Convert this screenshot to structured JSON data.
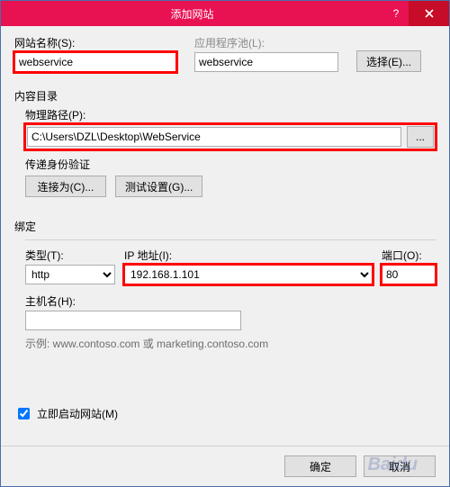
{
  "title": "添加网站",
  "site_name_label": "网站名称(S):",
  "site_name_value": "webservice",
  "app_pool_label": "应用程序池(L):",
  "app_pool_value": "webservice",
  "select_btn": "选择(E)...",
  "content_dir_title": "内容目录",
  "physical_path_label": "物理路径(P):",
  "physical_path_value": "C:\\Users\\DZL\\Desktop\\WebService",
  "browse_btn": "...",
  "auth_label": "传递身份验证",
  "connect_as_btn": "连接为(C)...",
  "test_settings_btn": "测试设置(G)...",
  "binding_title": "绑定",
  "type_label": "类型(T):",
  "type_value": "http",
  "ip_label": "IP 地址(I):",
  "ip_value": "192.168.1.101",
  "port_label": "端口(O):",
  "port_value": "80",
  "hostname_label": "主机名(H):",
  "hostname_value": "",
  "example_text": "示例: www.contoso.com 或 marketing.contoso.com",
  "start_now_label": "立即启动网站(M)",
  "ok_btn": "确定",
  "cancel_btn": "取消",
  "watermark": "Baidu"
}
